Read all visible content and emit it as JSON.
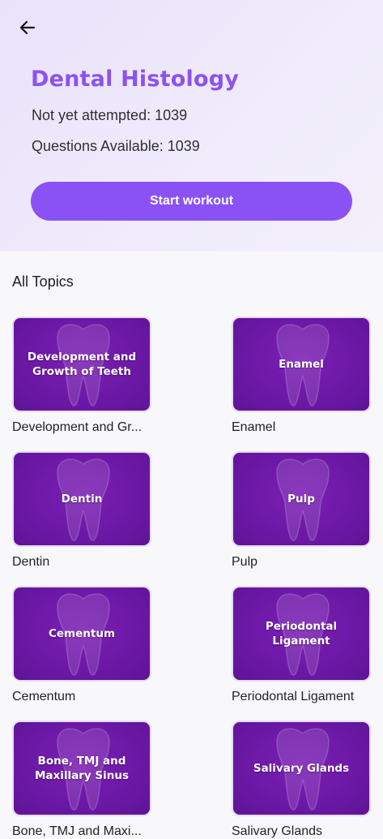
{
  "header": {
    "back_icon": "arrow-left-icon",
    "title": "Dental Histology",
    "not_attempted": "Not yet attempted: 1039",
    "questions_available": "Questions Available: 1039",
    "start_button": "Start workout",
    "colors": {
      "accent": "#8a52f5",
      "tile": "#6b18a5"
    }
  },
  "topics": {
    "section_title": "All Topics",
    "items": [
      {
        "tile_lines": [
          "Development and",
          "Growth of Teeth"
        ],
        "label": "Development and Gr..."
      },
      {
        "tile_lines": [
          "Enamel"
        ],
        "label": "Enamel"
      },
      {
        "tile_lines": [
          "Dentin"
        ],
        "label": "Dentin"
      },
      {
        "tile_lines": [
          "Pulp"
        ],
        "label": "Pulp"
      },
      {
        "tile_lines": [
          "Cementum"
        ],
        "label": "Cementum"
      },
      {
        "tile_lines": [
          "Periodontal Ligament"
        ],
        "label": "Periodontal Ligament"
      },
      {
        "tile_lines": [
          "Bone, TMJ and",
          "Maxillary Sinus"
        ],
        "label": "Bone, TMJ and Maxi..."
      },
      {
        "tile_lines": [
          "Salivary Glands"
        ],
        "label": "Salivary Glands"
      }
    ]
  }
}
